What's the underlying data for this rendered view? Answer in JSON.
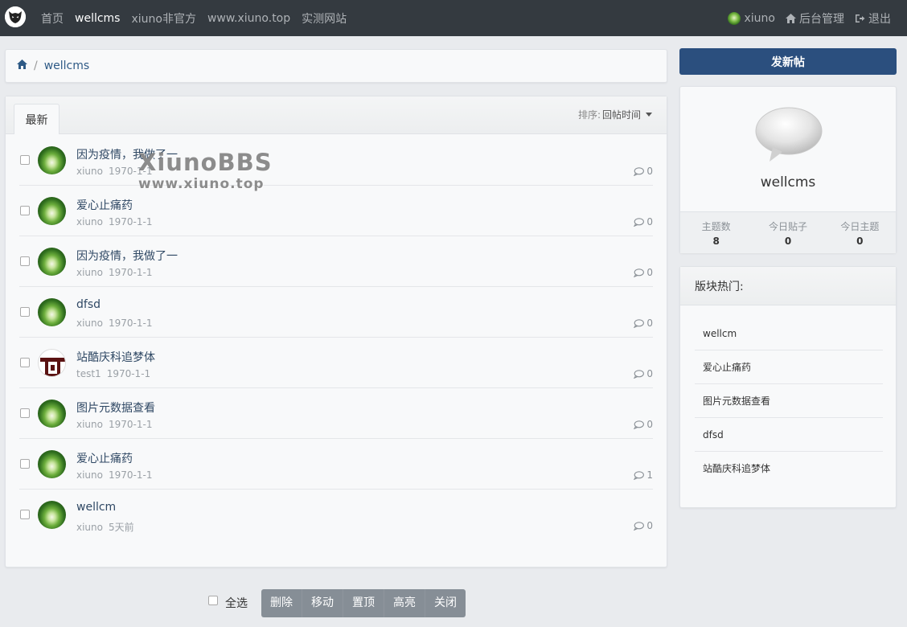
{
  "nav": {
    "items": [
      {
        "label": "首页"
      },
      {
        "label": "wellcms"
      },
      {
        "label": "xiuno非官方"
      },
      {
        "label": "www.xiuno.top"
      },
      {
        "label": "实测网站"
      }
    ],
    "user": "xiuno",
    "admin": "后台管理",
    "logout": "退出"
  },
  "breadcrumb": {
    "current": "wellcms",
    "separator": "/"
  },
  "threads": {
    "tab": "最新",
    "sort_label": "排序:",
    "sort_value": "回帖时间",
    "items": [
      {
        "title": "因为疫情，我做了一",
        "author": "xiuno",
        "date": "1970-1-1",
        "replies": "0",
        "avatar": "forest"
      },
      {
        "title": "爱心止痛药",
        "author": "xiuno",
        "date": "1970-1-1",
        "replies": "0",
        "avatar": "forest"
      },
      {
        "title": "因为疫情，我做了一",
        "author": "xiuno",
        "date": "1970-1-1",
        "replies": "0",
        "avatar": "forest"
      },
      {
        "title": "dfsd",
        "author": "xiuno",
        "date": "1970-1-1",
        "replies": "0",
        "avatar": "forest"
      },
      {
        "title": "站酷庆科追梦体",
        "author": "test1",
        "date": "1970-1-1",
        "replies": "0",
        "avatar": "red-logo"
      },
      {
        "title": "图片元数据查看",
        "author": "xiuno",
        "date": "1970-1-1",
        "replies": "0",
        "avatar": "forest"
      },
      {
        "title": "爱心止痛药",
        "author": "xiuno",
        "date": "1970-1-1",
        "replies": "1",
        "avatar": "forest"
      },
      {
        "title": "wellcm",
        "author": "xiuno",
        "date": "5天前",
        "replies": "0",
        "avatar": "forest"
      }
    ]
  },
  "watermark": {
    "line1": "XiunoBBS",
    "line2": "www.xiuno.top"
  },
  "mod": {
    "select_all": "全选",
    "actions": [
      "删除",
      "移动",
      "置顶",
      "高亮",
      "关闭"
    ]
  },
  "sidebar": {
    "new_thread": "发新帖",
    "forum_name": "wellcms",
    "stats": [
      {
        "label": "主题数",
        "value": "8"
      },
      {
        "label": "今日贴子",
        "value": "0"
      },
      {
        "label": "今日主题",
        "value": "0"
      }
    ],
    "hot_title": "版块热门:",
    "hot_items": [
      "wellcm",
      "爱心止痛药",
      "图片元数据查看",
      "dfsd",
      "站酷庆科追梦体"
    ]
  },
  "colors": {
    "topbar": "#343a40",
    "accent": "#2b4f7e",
    "modbar": "#868e96"
  }
}
